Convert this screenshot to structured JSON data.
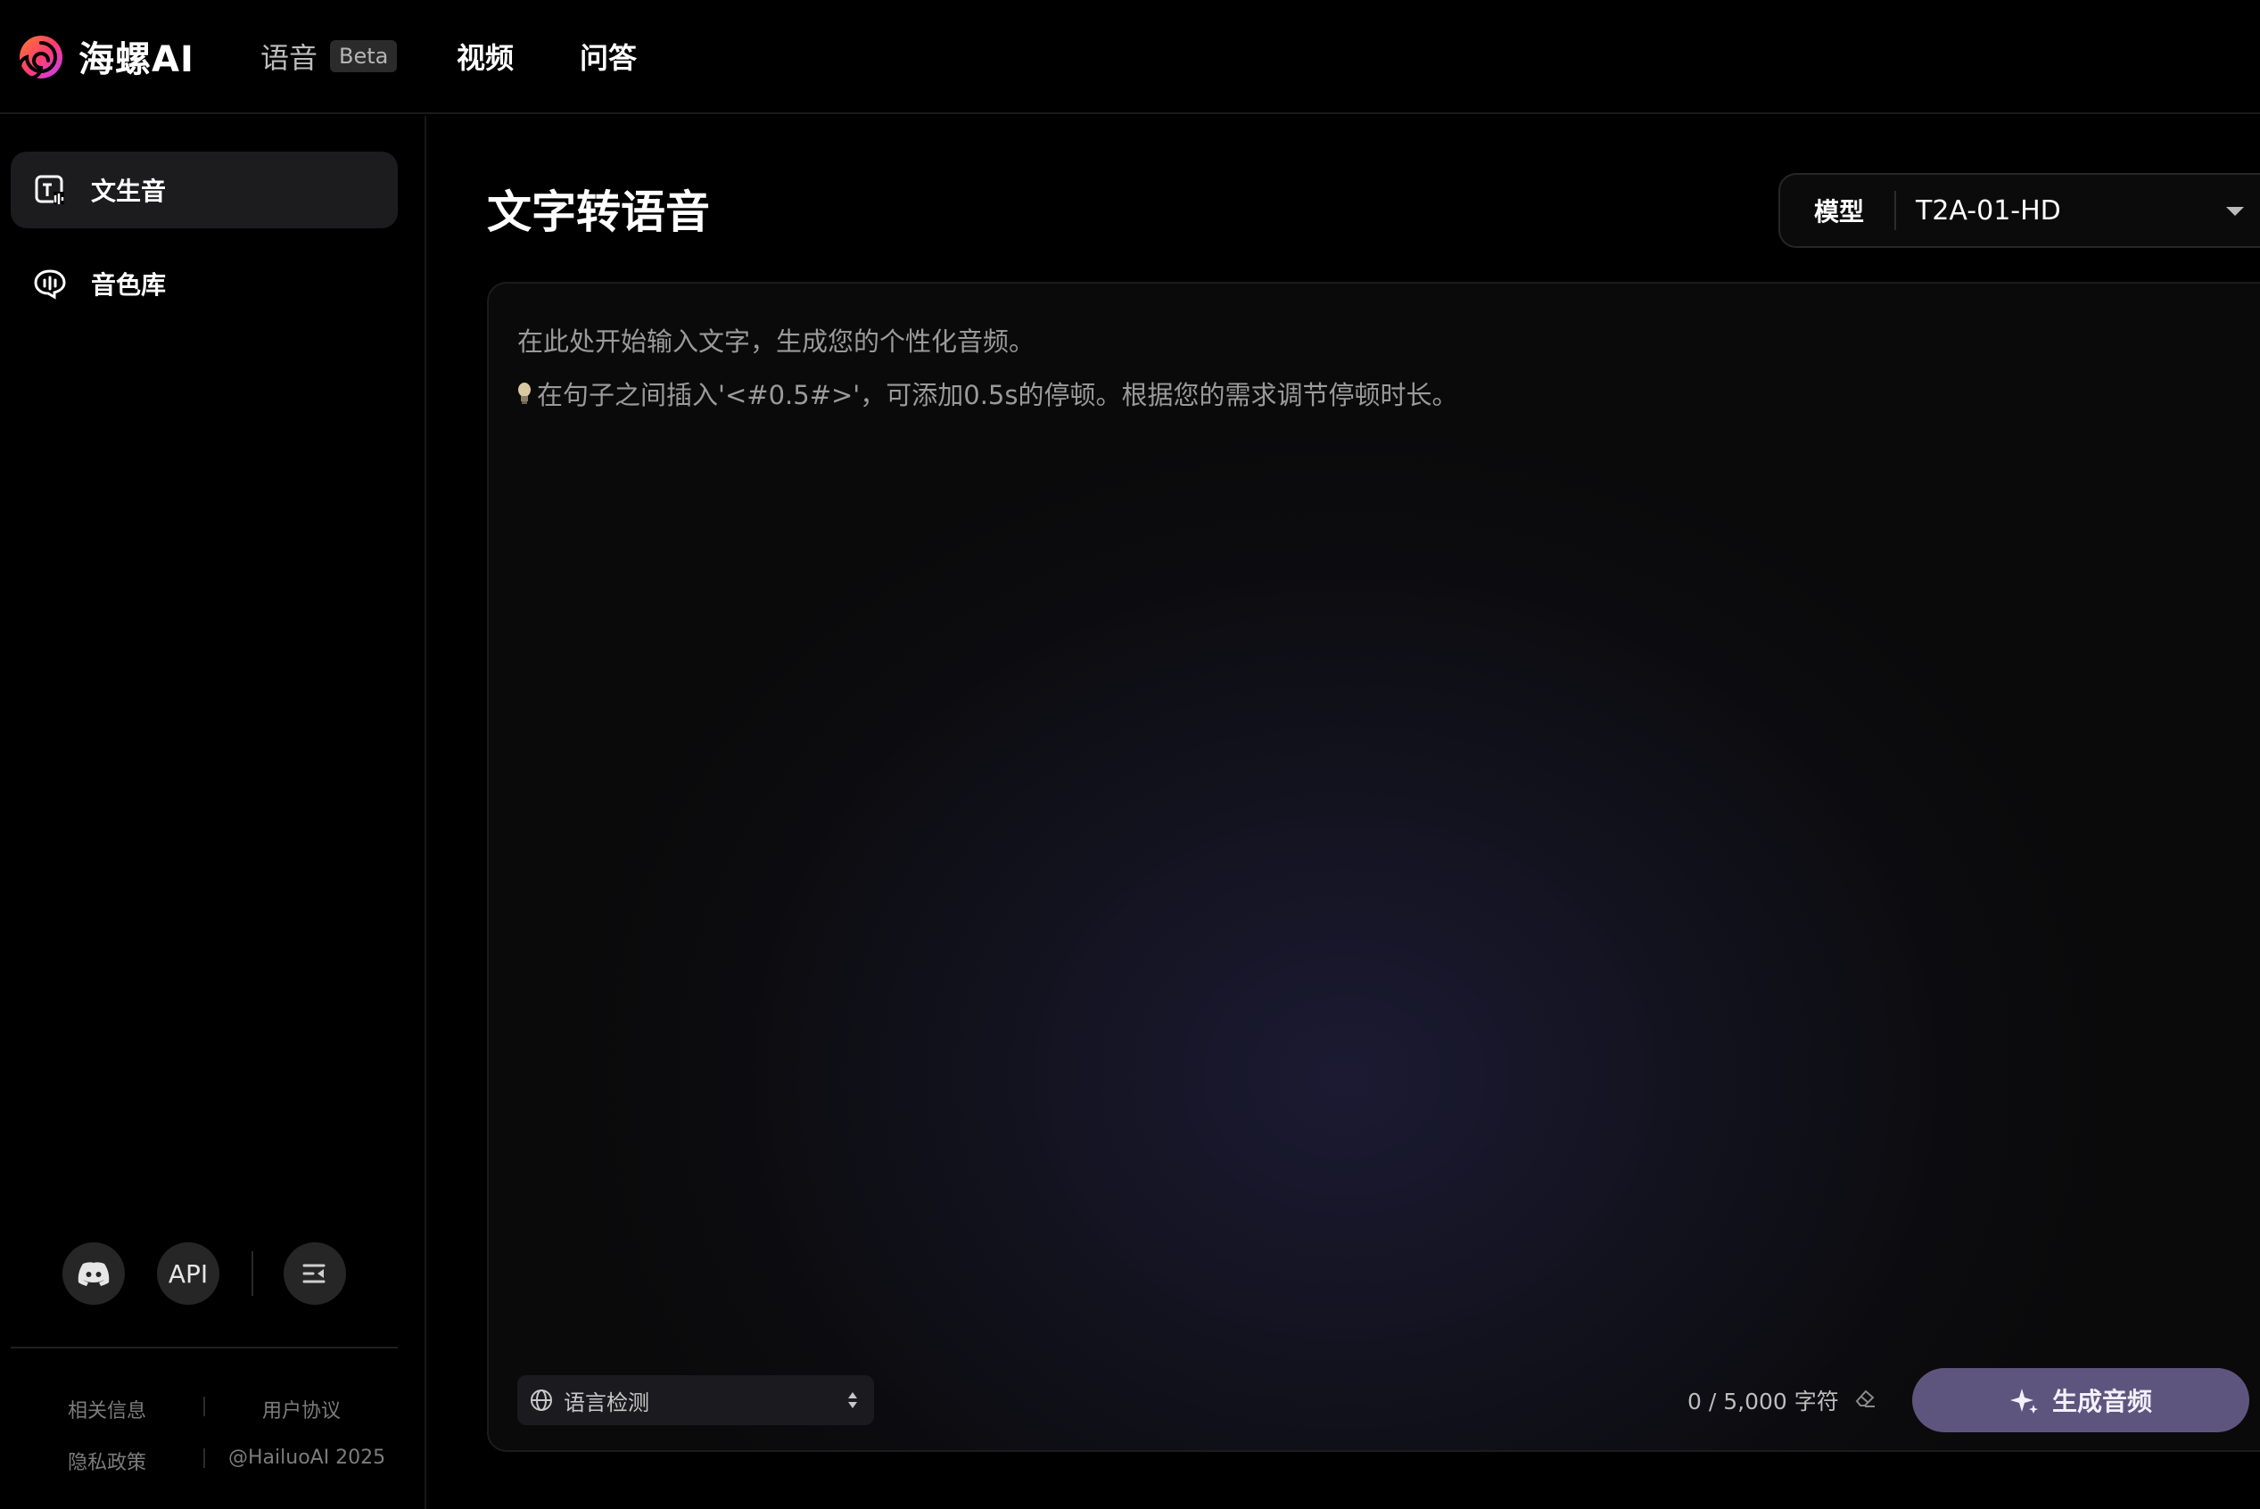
{
  "header": {
    "brand": "海螺AI",
    "nav": {
      "voice": "语音",
      "beta": "Beta",
      "video": "视频",
      "qa": "问答"
    }
  },
  "sidebar": {
    "items": [
      {
        "label": "文生音",
        "icon": "text-to-speech-icon",
        "active": true
      },
      {
        "label": "音色库",
        "icon": "voice-library-icon",
        "active": false
      }
    ],
    "bottom_buttons": {
      "discord_icon": "discord-icon",
      "api_label": "API",
      "collapse_icon": "collapse-sidebar-icon"
    },
    "footer": {
      "related_info": "相关信息",
      "user_agreement": "用户协议",
      "privacy_policy": "隐私政策",
      "copyright": "@HailuoAI 2025"
    }
  },
  "main": {
    "title": "文字转语音",
    "model": {
      "label": "模型",
      "value": "T2A-01-HD"
    },
    "editor": {
      "placeholder_line1": "在此处开始输入文字，生成您的个性化音频。",
      "placeholder_line2": "在句子之间插入'<#0.5#>'，可添加0.5s的停顿。根据您的需求调节停顿时长。"
    },
    "language_select": {
      "value": "语言检测"
    },
    "char_count": "0 / 5,000 字符",
    "generate_button": "生成音频"
  },
  "colors": {
    "background": "#000000",
    "accent_button": "#5e557f",
    "sidebar_active": "#1c1c1e"
  }
}
